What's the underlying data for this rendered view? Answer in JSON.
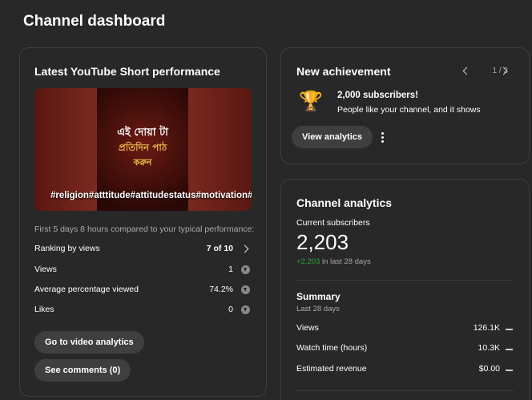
{
  "page": {
    "title": "Channel dashboard"
  },
  "short_card": {
    "title": "Latest YouTube Short performance",
    "thumbnail": {
      "overlay_lines": [
        "এই দোয়া টা",
        "প্রতিদিন পাঠ",
        "করুন"
      ],
      "hashtags": "#religion#atttitude#attitudestatus#motivation#"
    },
    "compare_text": "First 5 days 8 hours compared to your typical performance:",
    "metrics": [
      {
        "label": "Ranking by views",
        "value": "7 of 10",
        "icon": "chevron-right-icon"
      },
      {
        "label": "Views",
        "value": "1",
        "icon": "arrow-down-circle-icon"
      },
      {
        "label": "Average percentage viewed",
        "value": "74.2%",
        "icon": "arrow-down-circle-icon"
      },
      {
        "label": "Likes",
        "value": "0",
        "icon": "arrow-down-circle-icon"
      }
    ],
    "buttons": {
      "video_analytics": "Go to video analytics",
      "comments": "See comments (0)"
    }
  },
  "achievement_card": {
    "title": "New achievement",
    "pager": "1 / 3",
    "achievement_title": "2,000 subscribers!",
    "achievement_subtitle": "People like your channel, and it shows",
    "button": "View analytics",
    "icon": "trophy-icon"
  },
  "analytics_card": {
    "title": "Channel analytics",
    "subscribers_label": "Current subscribers",
    "subscribers_value": "2,203",
    "delta_value": "+2,203",
    "delta_text": " in last 28 days",
    "delta_color": "#2ba640",
    "summary_title": "Summary",
    "summary_period": "Last 28 days",
    "rows": [
      {
        "label": "Views",
        "value": "126.1K"
      },
      {
        "label": "Watch time (hours)",
        "value": "10.3K"
      },
      {
        "label": "Estimated revenue",
        "value": "$0.00"
      }
    ]
  }
}
